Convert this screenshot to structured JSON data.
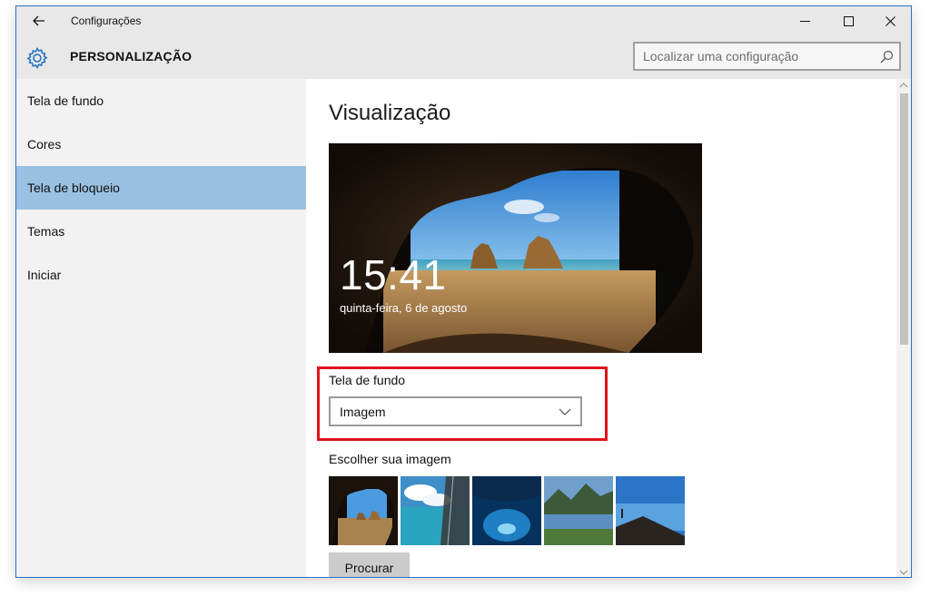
{
  "window": {
    "title": "Configurações",
    "controls": [
      "minimize-icon",
      "maximize-icon",
      "close-icon"
    ]
  },
  "header": {
    "title": "PERSONALIZAÇÃO",
    "icon": "gear-icon",
    "search_placeholder": "Localizar uma configuração",
    "search_value": ""
  },
  "sidebar": {
    "items": [
      {
        "label": "Tela de fundo",
        "active": false
      },
      {
        "label": "Cores",
        "active": false
      },
      {
        "label": "Tela de bloqueio",
        "active": true
      },
      {
        "label": "Temas",
        "active": false
      },
      {
        "label": "Iniciar",
        "active": false
      }
    ]
  },
  "main": {
    "heading": "Visualização",
    "preview": {
      "time": "15:41",
      "date": "quinta-feira, 6 de agosto"
    },
    "background": {
      "label": "Tela de fundo",
      "selected": "Imagem"
    },
    "choose_image": {
      "label": "Escolher sua imagem"
    },
    "browse_label": "Procurar"
  },
  "colors": {
    "accent": "#99c1e2",
    "highlight_border": "#e0131b",
    "window_border": "#2b73c2",
    "title_bar": "#e8e8e8",
    "sidebar_bg": "#f2f2f2"
  }
}
